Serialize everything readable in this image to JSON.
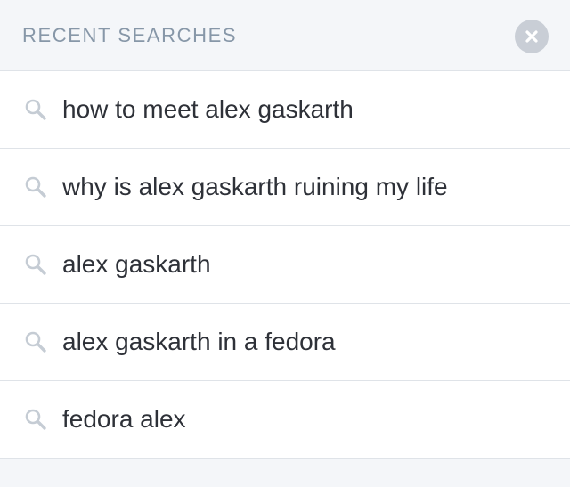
{
  "header": {
    "title": "RECENT SEARCHES",
    "close_icon": "close-icon"
  },
  "colors": {
    "header_text": "#8797a8",
    "item_text": "#2e3138",
    "icon": "#c5ccd4",
    "close_bg": "#c9ced6",
    "divider": "#dfe3e8",
    "background": "#f4f6f9"
  },
  "recent_searches": [
    {
      "label": "how to meet alex gaskarth",
      "icon": "search-icon"
    },
    {
      "label": "why is alex gaskarth ruining my life",
      "icon": "search-icon"
    },
    {
      "label": "alex gaskarth",
      "icon": "search-icon"
    },
    {
      "label": "alex gaskarth in a fedora",
      "icon": "search-icon"
    },
    {
      "label": "fedora alex",
      "icon": "search-icon"
    }
  ]
}
